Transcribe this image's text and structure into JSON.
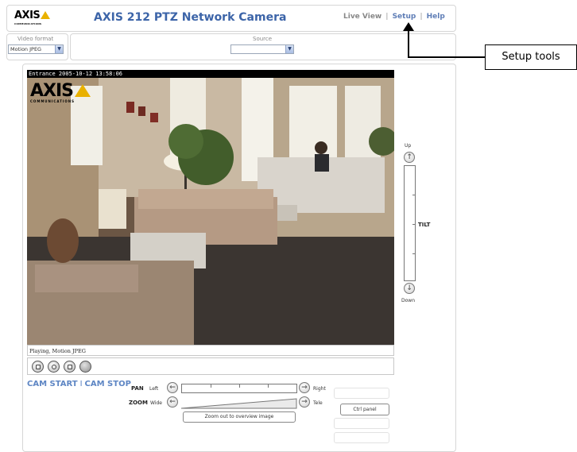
{
  "header": {
    "logo": "AXIS",
    "logo_tagline": "COMMUNICATIONS",
    "title": "AXIS 212 PTZ Network Camera",
    "nav": {
      "live_view": "Live View",
      "separator": "|",
      "setup": "Setup",
      "help": "Help"
    }
  },
  "video_format": {
    "label": "Video format",
    "value": "Motion JPEG"
  },
  "source": {
    "label": "Source",
    "value": ""
  },
  "video": {
    "overlay_text": "Entrance 2005-10-12 13:58:06",
    "logo": "AXIS",
    "logo_tagline": "COMMUNICATIONS"
  },
  "status": {
    "text": "Playing, Motion JPEG"
  },
  "cam_links": {
    "start": "CAM START",
    "separator": "I",
    "stop": "CAM STOP"
  },
  "ptz": {
    "pan": {
      "label": "PAN",
      "left": "Left",
      "right": "Right"
    },
    "zoom": {
      "label": "ZOOM",
      "wide": "Wide",
      "tele": "Tele"
    },
    "zoom_out_button": "Zoom out to overview image",
    "ctrl_panel_button": "Ctrl panel",
    "tilt": {
      "label": "TILT",
      "up": "Up",
      "down": "Down"
    }
  },
  "callout": {
    "label": "Setup tools"
  }
}
